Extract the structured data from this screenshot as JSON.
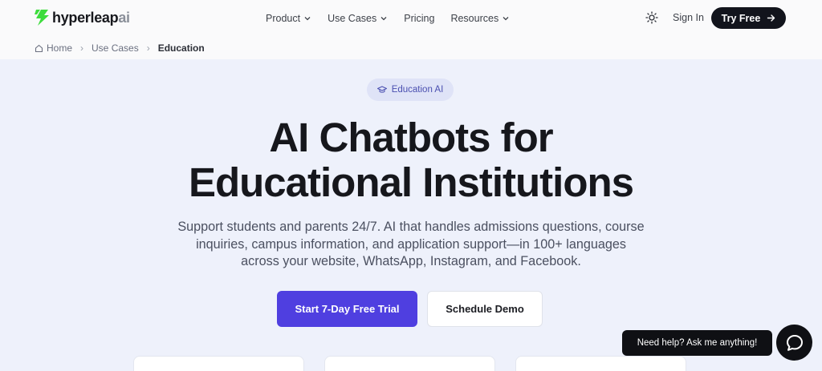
{
  "brand": {
    "name_main": "hyperleap",
    "name_suffix": "ai",
    "accent": "#3ddc3d"
  },
  "nav": {
    "items": [
      {
        "label": "Product",
        "has_dropdown": true
      },
      {
        "label": "Use Cases",
        "has_dropdown": true
      },
      {
        "label": "Pricing",
        "has_dropdown": false
      },
      {
        "label": "Resources",
        "has_dropdown": true
      }
    ],
    "theme_icon": "sun-icon",
    "signin_label": "Sign In",
    "cta_label": "Try Free"
  },
  "breadcrumb": [
    "Home",
    "Use Cases",
    "Education"
  ],
  "hero": {
    "badge": "Education AI",
    "title_line1": "AI Chatbots for",
    "title_line2": "Educational Institutions",
    "subtitle_line1": "Support students and parents 24/7. AI that handles admissions questions, course",
    "subtitle_line2": "inquiries, campus information, and application support—in 100+ languages",
    "subtitle_line3": "across your website, WhatsApp, Instagram, and Facebook.",
    "primary_cta": "Start 7-Day Free Trial",
    "secondary_cta": "Schedule Demo"
  },
  "chat_widget": {
    "prompt": "Need help? Ask me anything!"
  },
  "colors": {
    "primary": "#4f3fe0",
    "dark": "#12141c",
    "hero_bg": "#eef1fb"
  }
}
